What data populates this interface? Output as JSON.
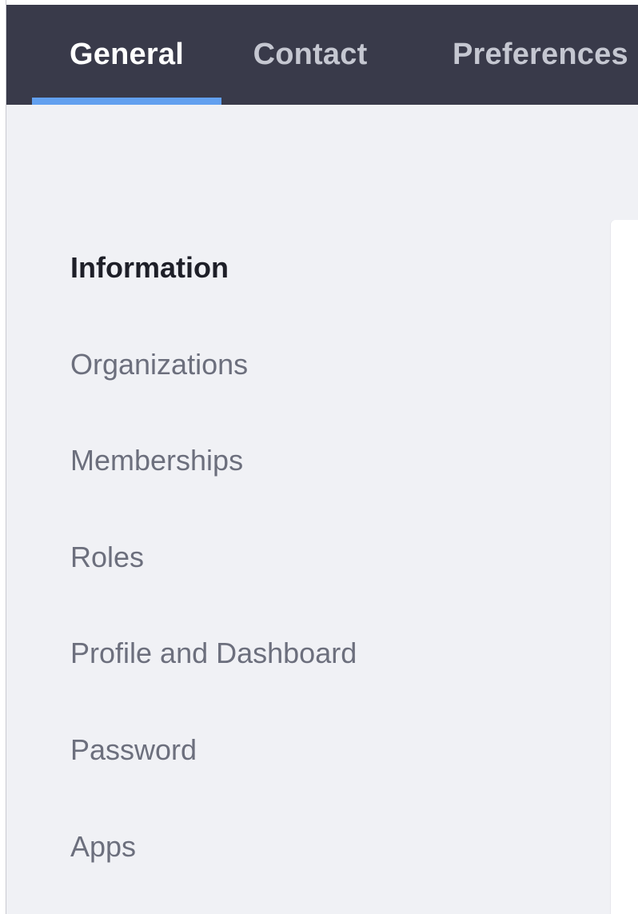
{
  "tabs": [
    {
      "label": "General",
      "active": true
    },
    {
      "label": "Contact",
      "active": false
    },
    {
      "label": "Preferences",
      "active": false
    }
  ],
  "sidebar": {
    "items": [
      {
        "label": "Information",
        "active": true
      },
      {
        "label": "Organizations",
        "active": false
      },
      {
        "label": "Memberships",
        "active": false
      },
      {
        "label": "Roles",
        "active": false
      },
      {
        "label": "Profile and Dashboard",
        "active": false
      },
      {
        "label": "Password",
        "active": false
      },
      {
        "label": "Apps",
        "active": false
      }
    ]
  },
  "colors": {
    "tabbar_background": "#393a4a",
    "active_tab_indicator": "#62a0ef",
    "content_background": "#f0f1f5",
    "active_text": "#1e1f28",
    "inactive_text": "#6c6f7d"
  }
}
